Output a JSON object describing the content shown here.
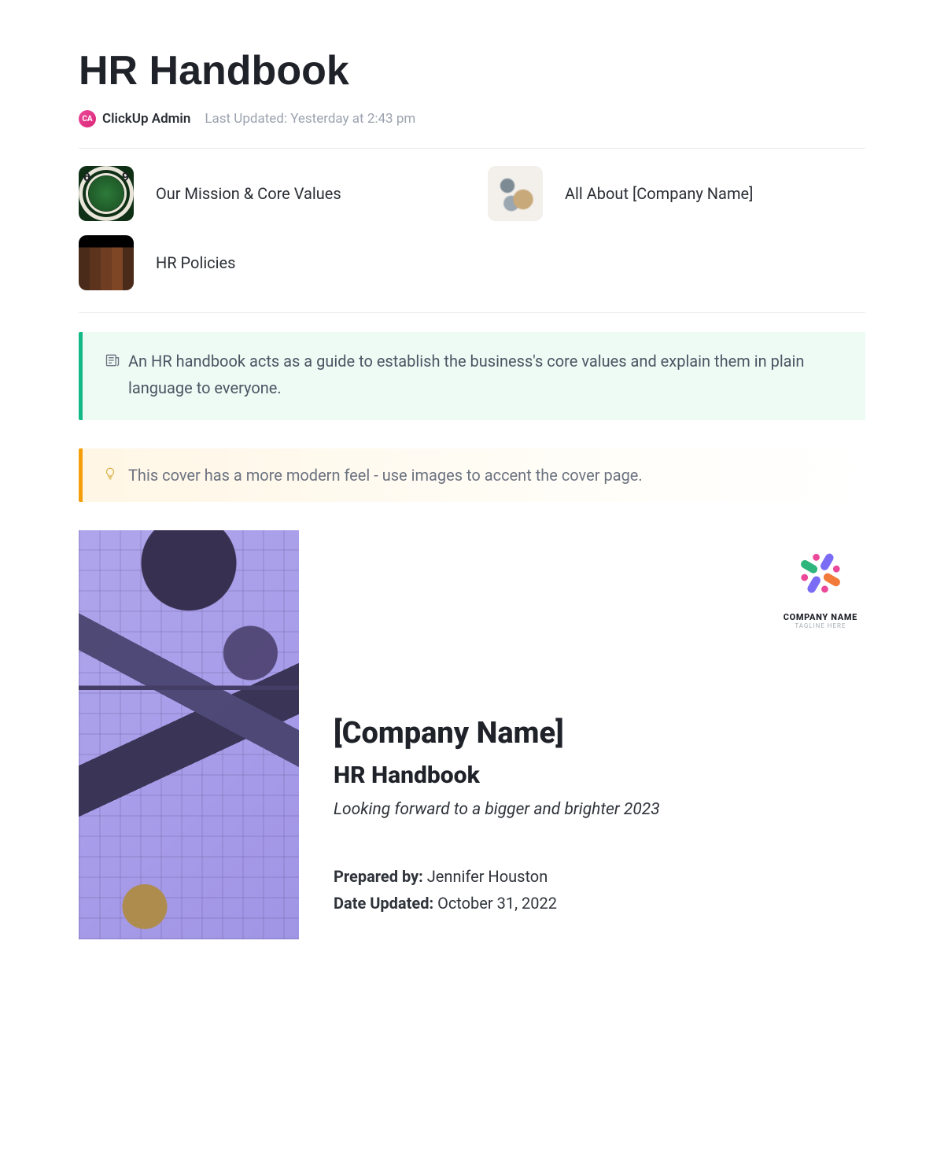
{
  "page": {
    "title": "HR Handbook",
    "author_initials": "CA",
    "author": "ClickUp Admin",
    "updated": "Last Updated: Yesterday at 2:43 pm"
  },
  "links": {
    "mission": "Our Mission & Core Values",
    "company": "All About [Company Name]",
    "policies": "HR Policies"
  },
  "callouts": {
    "green": "An HR handbook acts as a guide to establish the business's core values and explain them in plain language to everyone.",
    "yellow": "This cover has a more modern feel - use images to accent the cover page."
  },
  "cover": {
    "logo_name": "COMPANY NAME",
    "logo_tagline": "TAGLINE HERE",
    "company": "[Company Name]",
    "subtitle": "HR Handbook",
    "tagline": "Looking forward to a bigger and brighter 2023",
    "prepared_by_label": "Prepared by:",
    "prepared_by_value": " Jennifer Houston",
    "date_updated_label": "Date Updated:",
    "date_updated_value": " October 31, 2022"
  }
}
